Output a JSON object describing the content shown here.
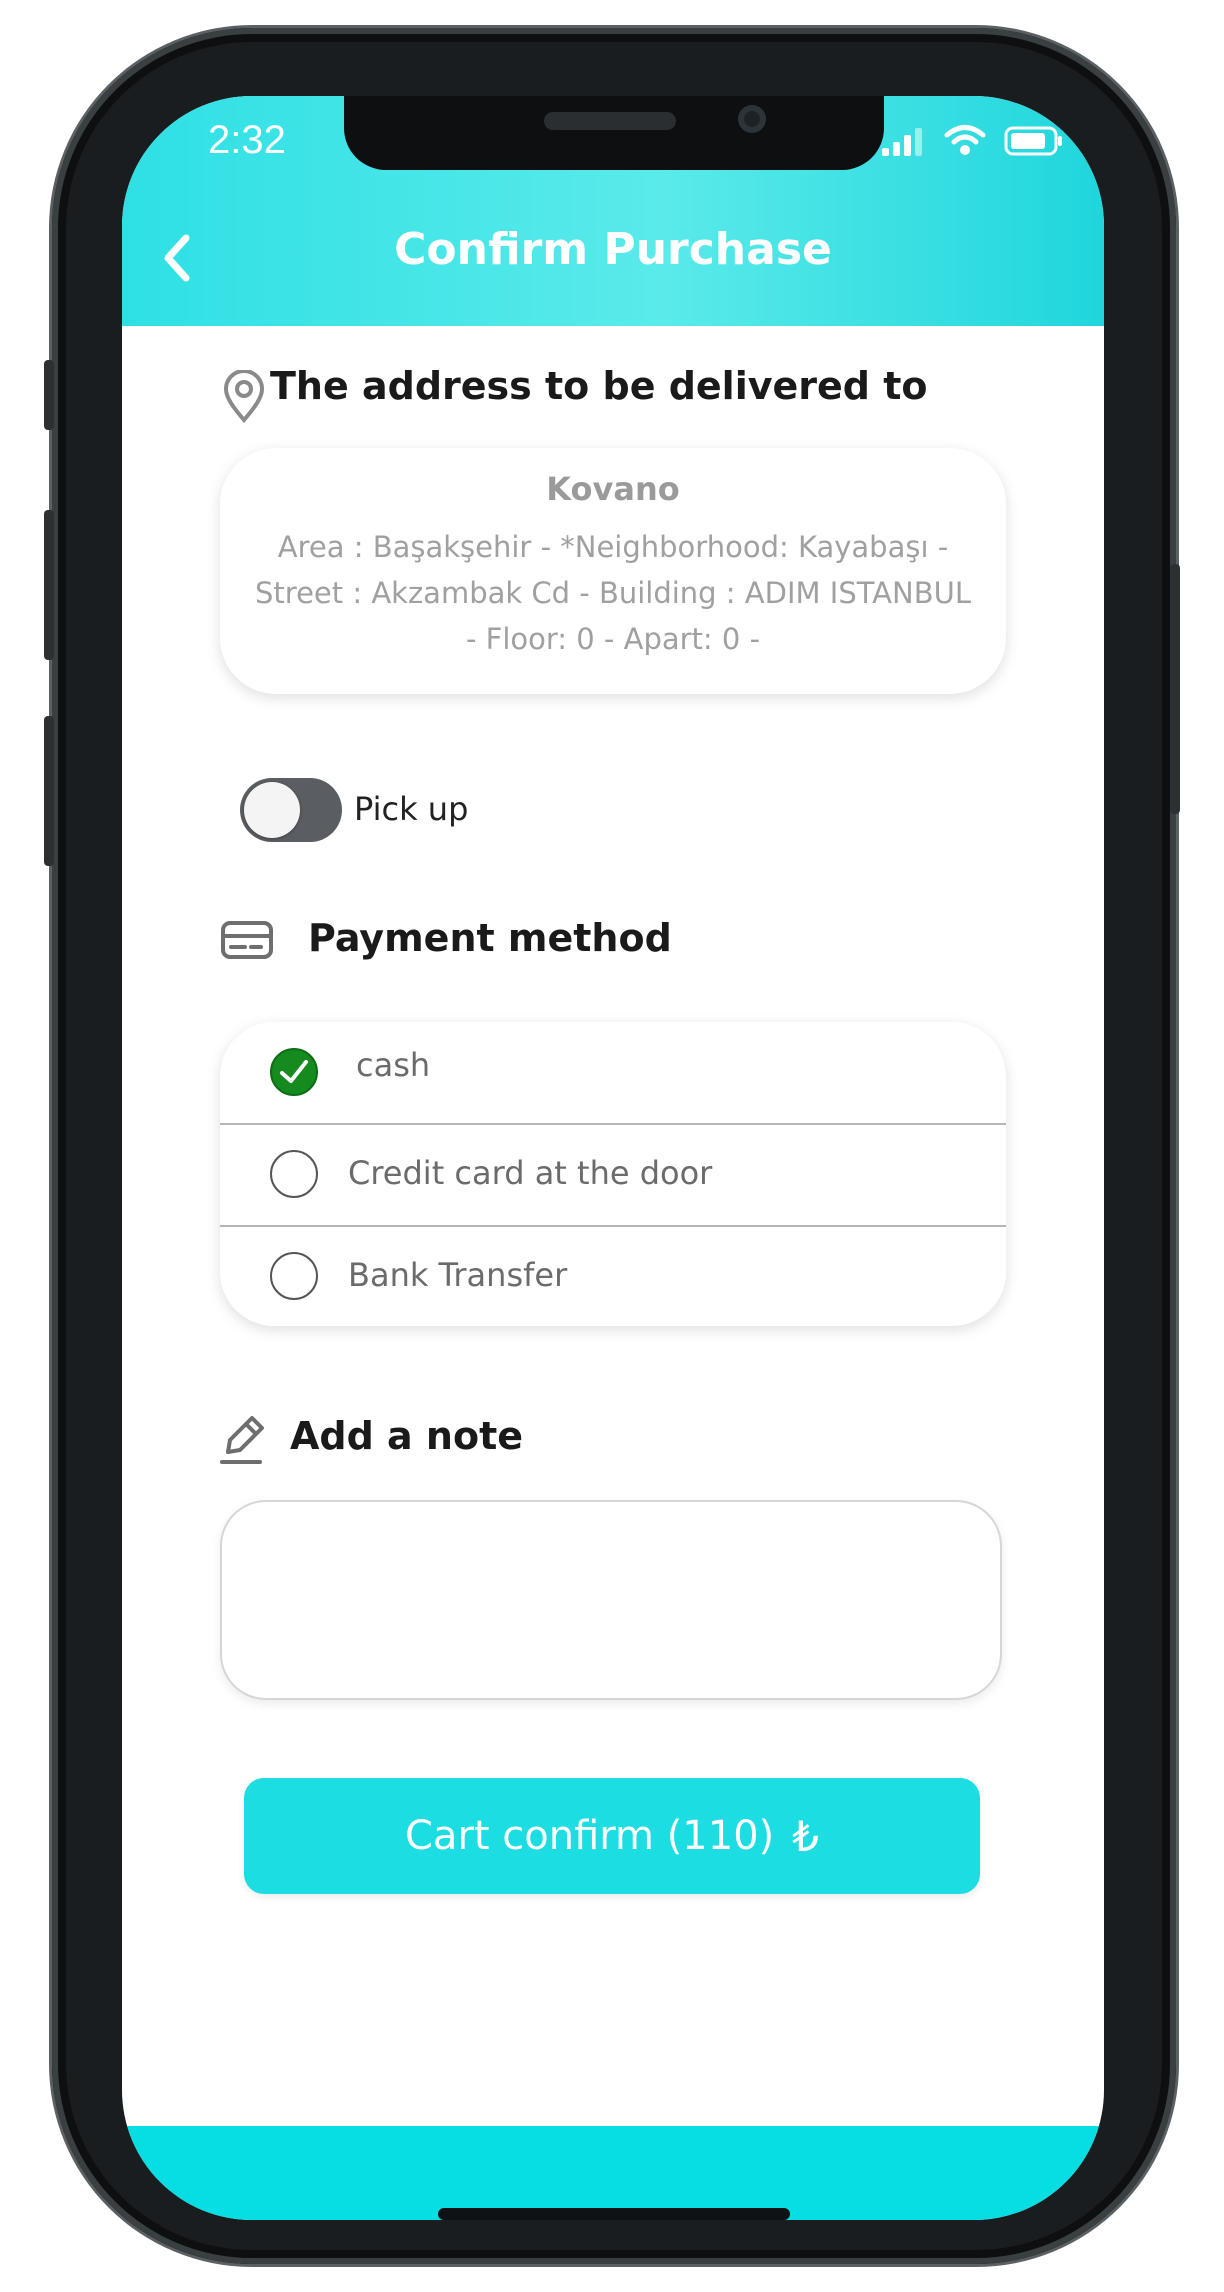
{
  "status_bar": {
    "time": "2:32"
  },
  "header": {
    "title": "Confirm Purchase"
  },
  "address_section": {
    "heading": "The address to be delivered to",
    "name": "Kovano",
    "lines": [
      "Area : Başakşehir - *Neighborhood: Kayabaşı -",
      "Street : Akzambak Cd -  Building : ADIM ISTANBUL",
      "-  Floor: 0 -  Apart: 0 -"
    ]
  },
  "pickup": {
    "label": "Pick up",
    "enabled": false
  },
  "payment_section": {
    "heading": "Payment method",
    "options": [
      {
        "label": "cash",
        "selected": true
      },
      {
        "label": "Credit card at the door",
        "selected": false
      },
      {
        "label": "Bank Transfer",
        "selected": false
      }
    ]
  },
  "note_section": {
    "heading": "Add a note",
    "value": ""
  },
  "confirm_button": {
    "label": "Cart confirm (110)",
    "currency_symbol": "₺"
  },
  "colors": {
    "accent": "#1bdde2",
    "selected_radio": "#148a1f"
  }
}
